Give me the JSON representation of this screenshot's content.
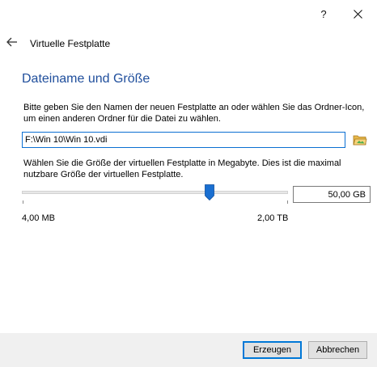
{
  "titlebar": {
    "help_label": "?"
  },
  "wizard": {
    "title": "Virtuelle Festplatte"
  },
  "section": {
    "title": "Dateiname und Größe",
    "file_description": "Bitte geben Sie den Namen der neuen Festplatte an oder wählen Sie das Ordner-Icon, um einen anderen Ordner für die Datei zu wählen.",
    "size_description": "Wählen Sie die Größe der virtuellen Festplatte in Megabyte. Dies ist die maximal nutzbare Größe der virtuellen Festplatte."
  },
  "file": {
    "path_value": "F:\\Win 10\\Win 10.vdi"
  },
  "size": {
    "value": "50,00 GB",
    "slider_fraction": 0.705,
    "min_label": "4,00 MB",
    "max_label": "2,00 TB"
  },
  "buttons": {
    "create_label": "Erzeugen",
    "cancel_label": "Abbrechen"
  },
  "icons": {
    "help": "help-icon",
    "close": "close-icon",
    "back": "back-arrow-icon",
    "folder": "folder-icon"
  },
  "colors": {
    "title_blue": "#1f4e9c",
    "accent": "#0078d7",
    "slider_thumb": "#1a6fd1"
  }
}
